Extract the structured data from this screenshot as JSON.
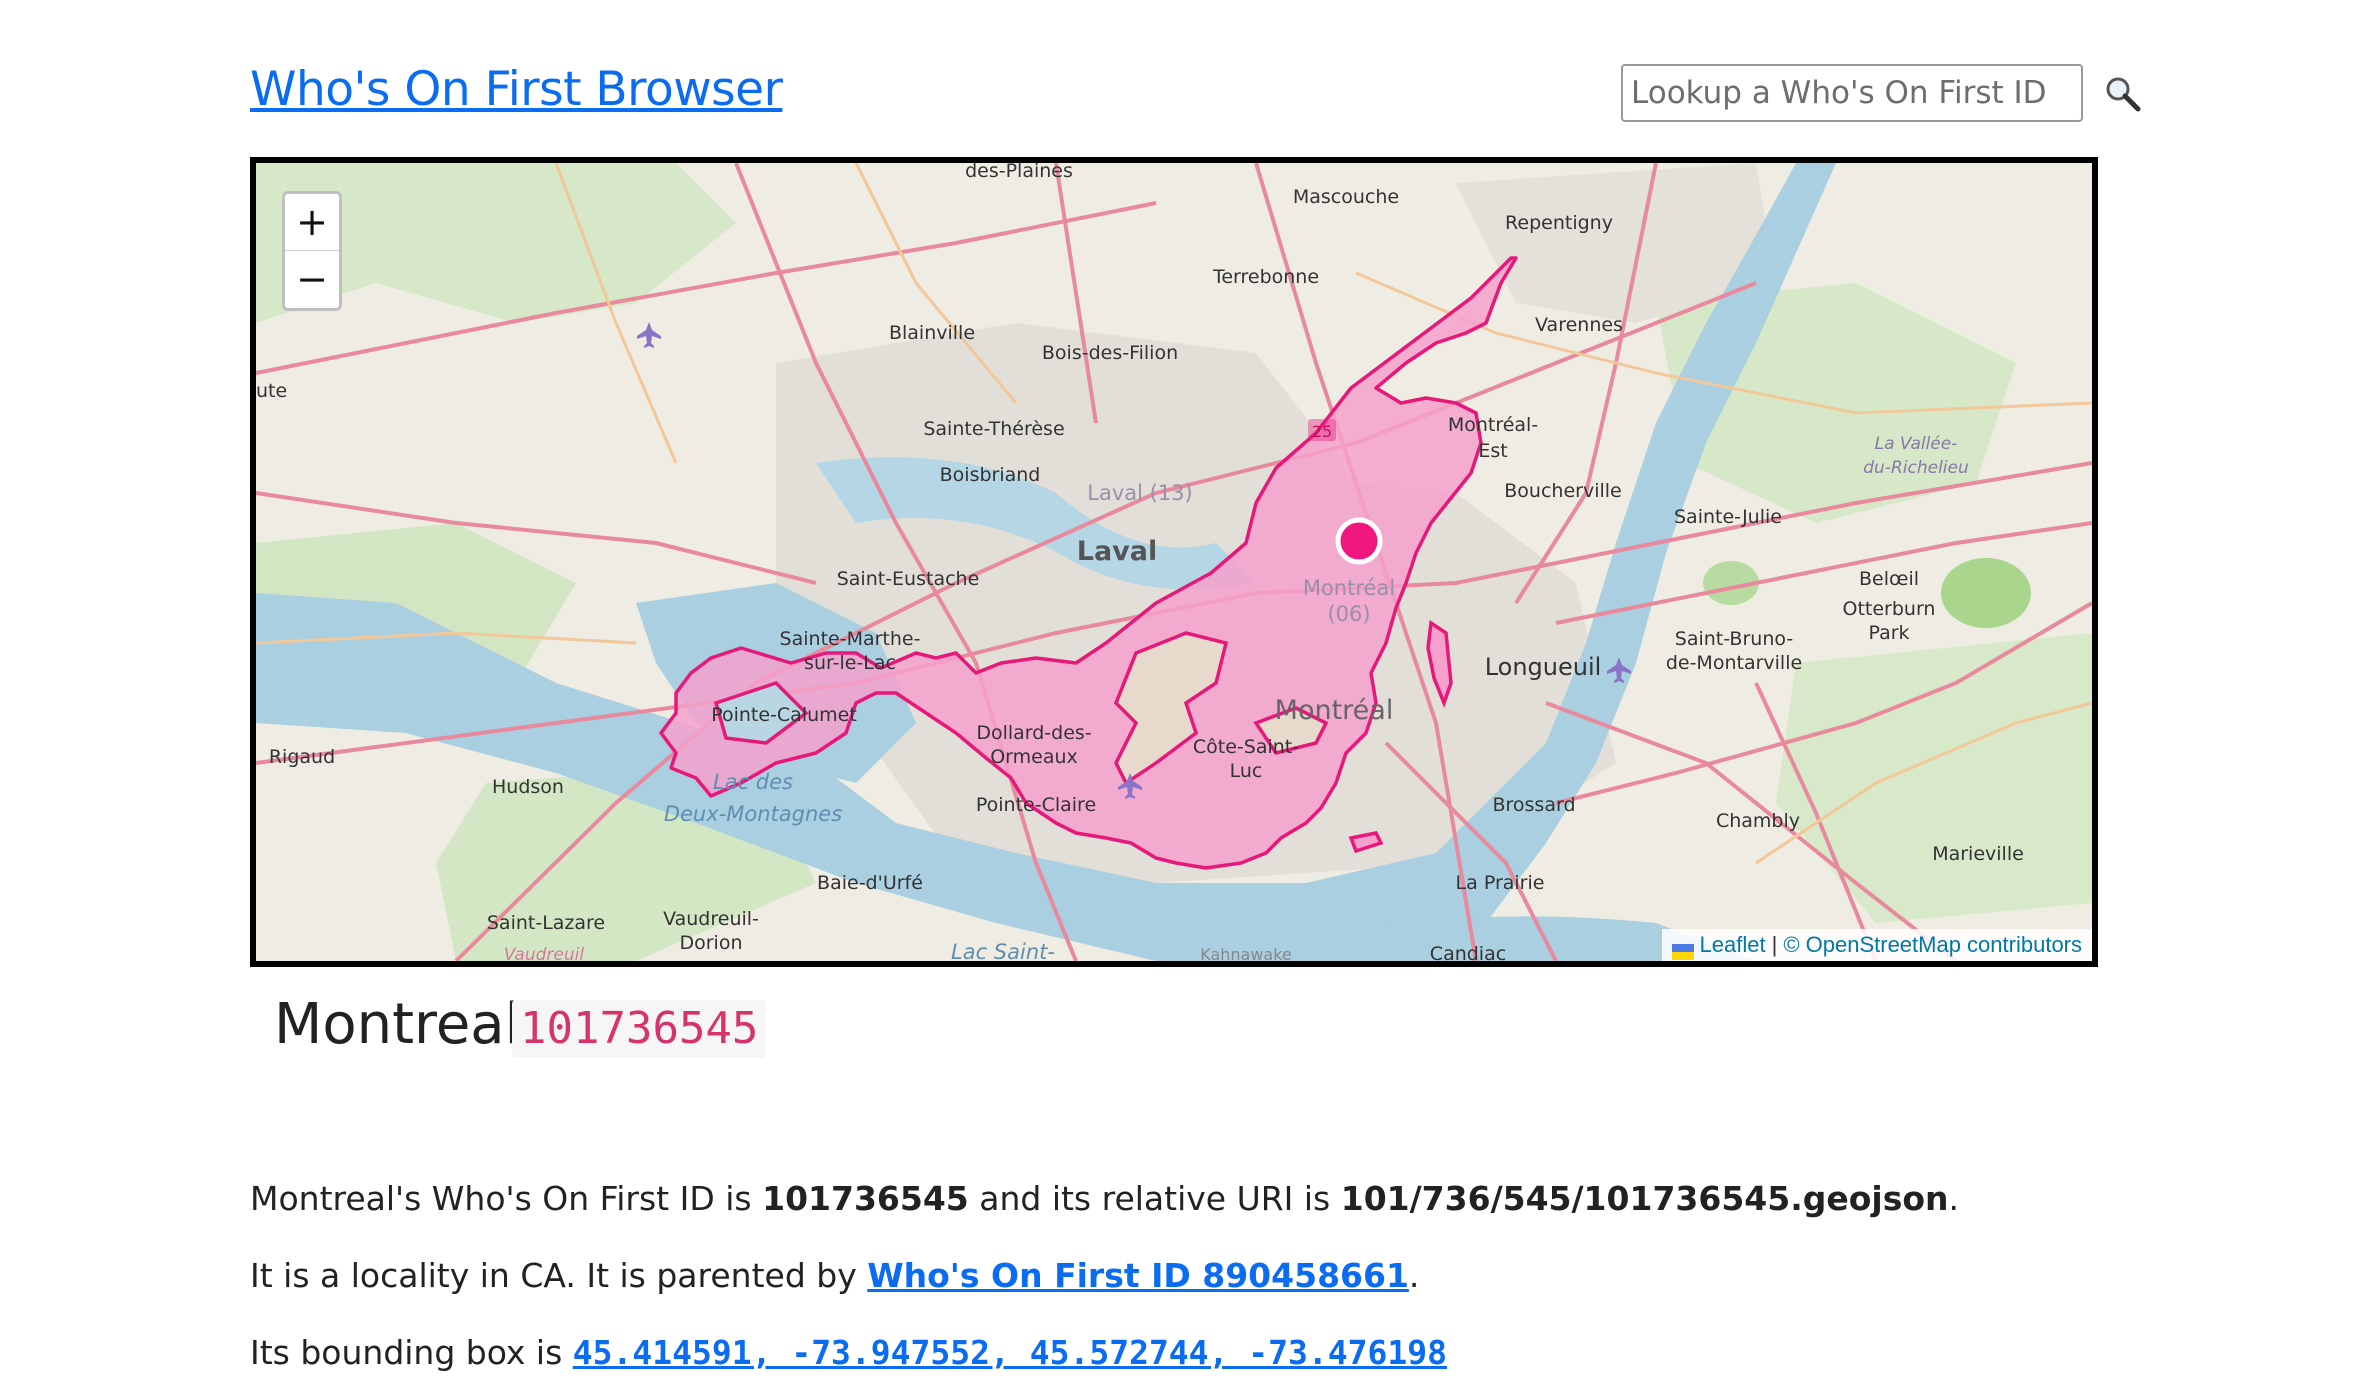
{
  "header": {
    "title": "Who's On First Browser",
    "search_placeholder": "Lookup a Who's On First ID"
  },
  "map": {
    "zoom_in_label": "+",
    "zoom_out_label": "−",
    "attribution": {
      "leaflet": "Leaflet",
      "separator": "|",
      "osm": "© OpenStreetMap contributors"
    },
    "labels": {
      "des_plaines": "des-Plaines",
      "mascouche": "Mascouche",
      "repentigny": "Repentigny",
      "terrebonne": "Terrebonne",
      "blainville": "Blainville",
      "bois_des_filion": "Bois-des-Filion",
      "varennes": "Varennes",
      "ute": "ute",
      "sainte_therese": "Sainte-Thérèse",
      "montreal_est_1": "Montréal-",
      "montreal_est_2": "Est",
      "la_vallee_1": "La Vallée-",
      "la_vallee_2": "du-Richelieu",
      "boisbriand": "Boisbriand",
      "laval_13": "Laval (13)",
      "boucherville": "Boucherville",
      "sainte_julie": "Sainte-Julie",
      "laval": "Laval",
      "saint_eustache": "Saint-Eustache",
      "montreal_06_1": "Montréal",
      "montreal_06_2": "(06)",
      "beloeil": "Belœil",
      "otterburn_1": "Otterburn",
      "otterburn_2": "Park",
      "sainte_marthe_1": "Sainte-Marthe-",
      "sainte_marthe_2": "sur-le-Lac",
      "saint_bruno_1": "Saint-Bruno-",
      "saint_bruno_2": "de-Montarville",
      "longueuil": "Longueuil",
      "pointe_calumet": "Pointe-Calumet",
      "montreal": "Montréal",
      "dollard_1": "Dollard-des-",
      "dollard_2": "Ormeaux",
      "cote_saint_luc_1": "Côte-Saint-",
      "cote_saint_luc_2": "Luc",
      "rigaud": "Rigaud",
      "hudson": "Hudson",
      "lac_des_1": "Lac des",
      "lac_des_2": "Deux-Montagnes",
      "pointe_claire": "Pointe-Claire",
      "brossard": "Brossard",
      "chambly": "Chambly",
      "marieville": "Marieville",
      "baie_durfe": "Baie-d'Urfé",
      "la_prairie": "La Prairie",
      "saint_lazare": "Saint-Lazare",
      "vaudreuil_1": "Vaudreuil-",
      "vaudreuil_2": "Dorion",
      "vaudreuil_faded": "Vaudreuil",
      "lac_saint": "Lac Saint-",
      "kahnawake": "Kahnawake",
      "candiac": "Candiac",
      "route_25": "25"
    }
  },
  "place": {
    "name": "Montreal",
    "id": "101736545"
  },
  "details": {
    "p1_prefix": "Montreal's Who's On First ID is ",
    "p1_id": "101736545",
    "p1_middle": " and its relative URI is ",
    "p1_uri": "101/736/545/101736545.geojson",
    "p1_suffix": ".",
    "p2_prefix": "It is a locality in CA. It is parented by ",
    "p2_link": "Who's On First ID 890458661",
    "p2_suffix": ".",
    "p3_prefix": "Its bounding box is ",
    "p3_bbox": "45.414591, -73.947552, 45.572744, -73.476198"
  },
  "colors": {
    "polygon_fill": "#f5a1cb",
    "polygon_stroke": "#e6187a",
    "marker": "#f0187f",
    "link": "#0a6cf0",
    "id_code": "#d6336c",
    "water": "#a9cfe0",
    "land": "#efece3"
  }
}
